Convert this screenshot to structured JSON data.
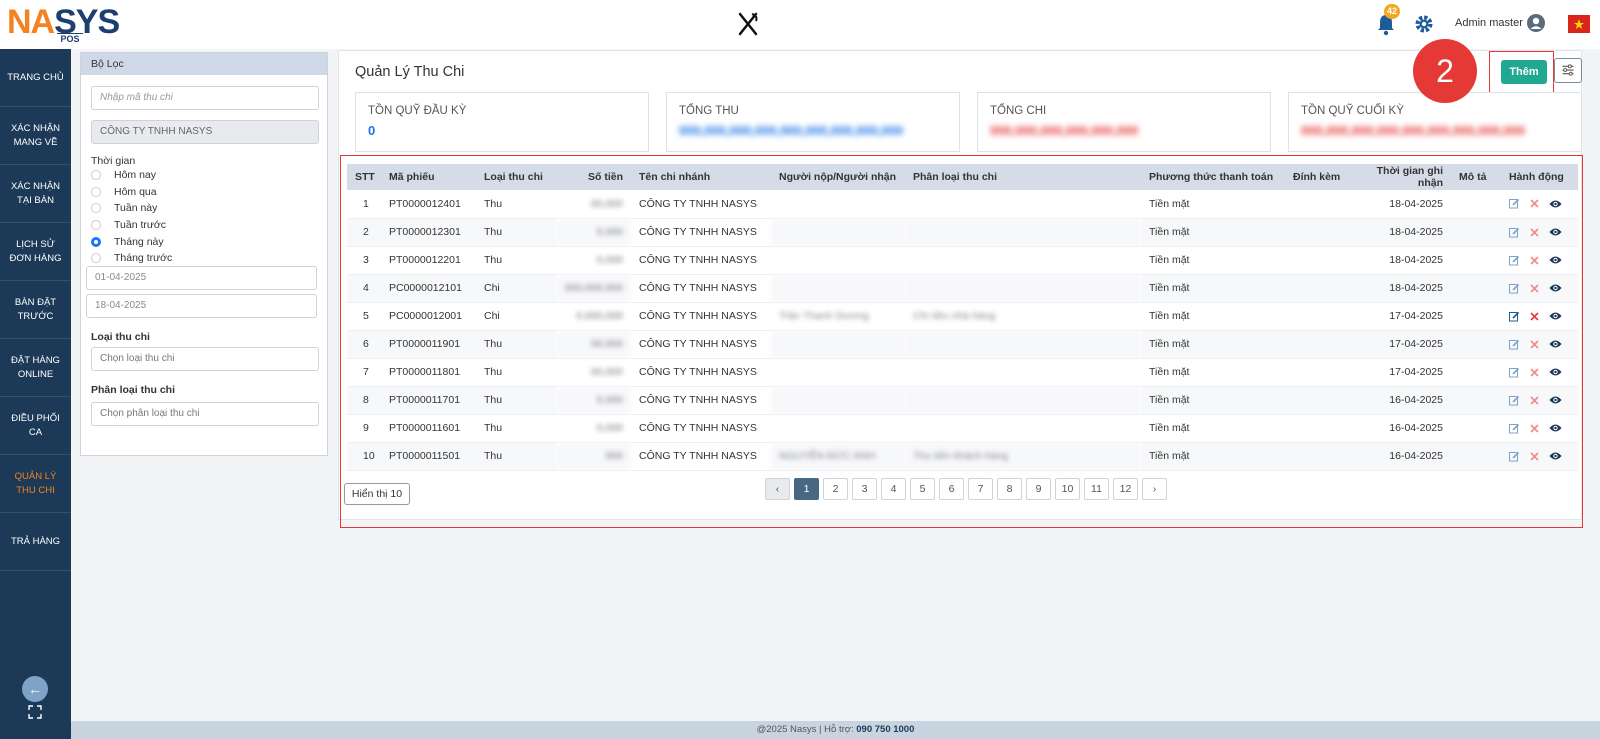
{
  "header": {
    "logo_main": "NASYS",
    "logo_sub": "POS",
    "notification_count": "42",
    "user_name": "Admin master"
  },
  "sidebar": {
    "items": [
      {
        "label": "TRANG CHỦ"
      },
      {
        "label": "XÁC NHẬN MANG VỀ"
      },
      {
        "label": "XÁC NHẬN TẠI BÀN"
      },
      {
        "label": "LỊCH SỬ ĐƠN HÀNG"
      },
      {
        "label": "BÀN ĐẶT TRƯỚC"
      },
      {
        "label": "ĐẶT HÀNG ONLINE"
      },
      {
        "label": "ĐIỀU PHỐI CA"
      },
      {
        "label": "QUẢN LÝ THU CHI",
        "active": true
      },
      {
        "label": "TRẢ HÀNG"
      }
    ]
  },
  "filter": {
    "title": "Bộ Lọc",
    "code_placeholder": "Nhập mã thu chi",
    "company": "CÔNG TY TNHH NASYS",
    "time_label": "Thời gian",
    "time_options": [
      "Hôm nay",
      "Hôm qua",
      "Tuần này",
      "Tuần trước",
      "Tháng này",
      "Tháng trước"
    ],
    "time_selected": "Tháng này",
    "date_from": "01-04-2025",
    "date_to": "18-04-2025",
    "type_label": "Loại thu chi",
    "type_placeholder": "Chọn loại thu chi",
    "category_label": "Phân loại thu chi",
    "category_placeholder": "Chọn phân loại thu chi"
  },
  "main": {
    "title": "Quản Lý Thu Chi",
    "add_button": "Thêm",
    "step_number": "2",
    "cards": [
      {
        "label": "TỒN QUỸ ĐẦU KỲ",
        "value": "0",
        "color": "#1a73e8"
      },
      {
        "label": "TỔNG THU",
        "value": "000,000,000,000,000,000,000,000,000",
        "color": "#1a73e8"
      },
      {
        "label": "TỔNG CHI",
        "value": "000,000,000,000,000,000",
        "color": "#e53935"
      },
      {
        "label": "TỒN QUỸ CUỐI KỲ",
        "value": "000,000,000,000,000,000,000,000,000",
        "color": "#e53935"
      }
    ]
  },
  "table": {
    "columns": [
      "STT",
      "Mã phiếu",
      "Loại thu chi",
      "Số tiền",
      "Tên chi nhánh",
      "Người nộp/Người nhận",
      "Phân loại thu chi",
      "Phương thức thanh toán",
      "Đính kèm",
      "Thời gian ghi nhận",
      "Mô tả",
      "Hành động"
    ],
    "rows": [
      {
        "stt": "1",
        "code": "PT0000012401",
        "type": "Thu",
        "amount": "00,000",
        "branch": "CÔNG TY TNHH NASYS",
        "person": "",
        "category": "",
        "method": "Tiền mặt",
        "date": "18-04-2025"
      },
      {
        "stt": "2",
        "code": "PT0000012301",
        "type": "Thu",
        "amount": "0,000",
        "branch": "CÔNG TY TNHH NASYS",
        "person": "",
        "category": "",
        "method": "Tiền mặt",
        "date": "18-04-2025"
      },
      {
        "stt": "3",
        "code": "PT0000012201",
        "type": "Thu",
        "amount": "0,000",
        "branch": "CÔNG TY TNHH NASYS",
        "person": "",
        "category": "",
        "method": "Tiền mặt",
        "date": "18-04-2025"
      },
      {
        "stt": "4",
        "code": "PC0000012101",
        "type": "Chi",
        "amount": "000,000,000",
        "branch": "CÔNG TY TNHH NASYS",
        "person": "",
        "category": "",
        "method": "Tiền mặt",
        "date": "18-04-2025"
      },
      {
        "stt": "5",
        "code": "PC0000012001",
        "type": "Chi",
        "amount": "0,000,000",
        "branch": "CÔNG TY TNHH NASYS",
        "person": "Trần Thanh Dương",
        "category": "Chi tiêu nhà hàng",
        "method": "Tiền mặt",
        "date": "17-04-2025"
      },
      {
        "stt": "6",
        "code": "PT0000011901",
        "type": "Thu",
        "amount": "00,000",
        "branch": "CÔNG TY TNHH NASYS",
        "person": "",
        "category": "",
        "method": "Tiền mặt",
        "date": "17-04-2025"
      },
      {
        "stt": "7",
        "code": "PT0000011801",
        "type": "Thu",
        "amount": "00,000",
        "branch": "CÔNG TY TNHH NASYS",
        "person": "",
        "category": "",
        "method": "Tiền mặt",
        "date": "17-04-2025"
      },
      {
        "stt": "8",
        "code": "PT0000011701",
        "type": "Thu",
        "amount": "0,000",
        "branch": "CÔNG TY TNHH NASYS",
        "person": "",
        "category": "",
        "method": "Tiền mặt",
        "date": "16-04-2025"
      },
      {
        "stt": "9",
        "code": "PT0000011601",
        "type": "Thu",
        "amount": "0,000",
        "branch": "CÔNG TY TNHH NASYS",
        "person": "",
        "category": "",
        "method": "Tiền mặt",
        "date": "16-04-2025"
      },
      {
        "stt": "10",
        "code": "PT0000011501",
        "type": "Thu",
        "amount": "000",
        "branch": "CÔNG TY TNHH NASYS",
        "person": "NGUYỄN ĐỨC ANH",
        "category": "Thu tiền khách hàng",
        "method": "Tiền mặt",
        "date": "16-04-2025"
      }
    ],
    "show_label": "Hiển thị 10",
    "pages": [
      "1",
      "2",
      "3",
      "4",
      "5",
      "6",
      "7",
      "8",
      "9",
      "10",
      "11",
      "12"
    ],
    "current_page": "1",
    "prev": "‹",
    "next": "›"
  },
  "footer": {
    "text": "@2025 Nasys | Hỗ trợ: ",
    "phone": "090 750 1000"
  }
}
